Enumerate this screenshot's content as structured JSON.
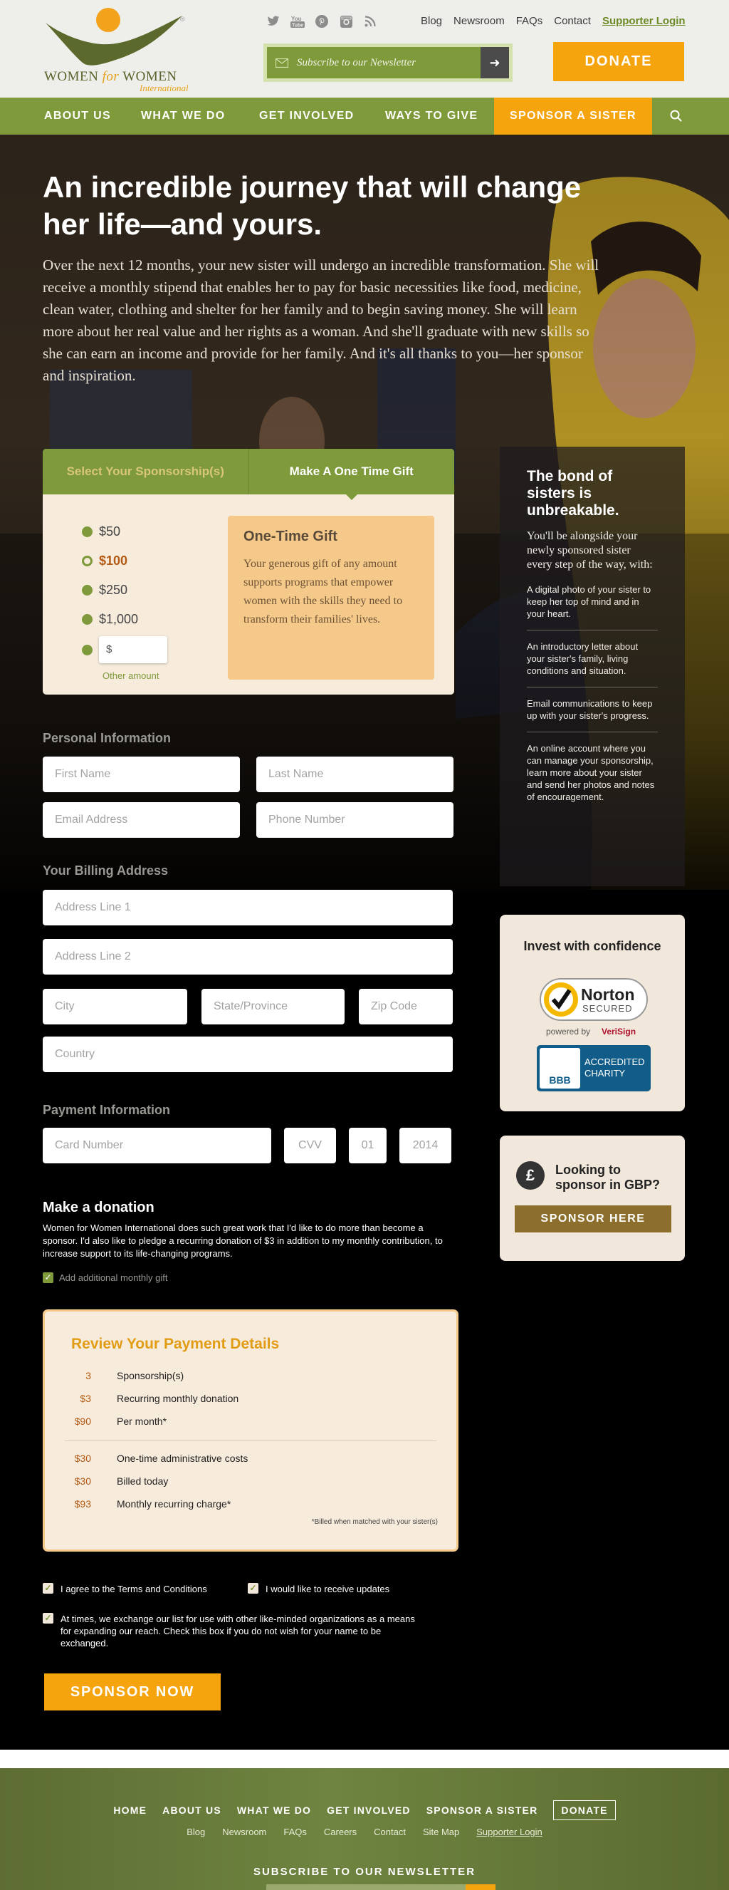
{
  "header": {
    "logo": {
      "line1": "WOMEN",
      "for": "for",
      "line2": "WOMEN",
      "intl": "International"
    },
    "socials": [
      "twitter-icon",
      "youtube-icon",
      "pinterest-icon",
      "instagram-icon",
      "rss-icon"
    ],
    "links": [
      "Blog",
      "Newsroom",
      "FAQs",
      "Contact"
    ],
    "login": "Supporter Login",
    "newsletter_placeholder": "Subscribe to our Newsletter",
    "donate": "DONATE"
  },
  "nav": {
    "items": [
      "ABOUT US",
      "WHAT WE DO",
      "GET INVOLVED",
      "WAYS TO GIVE"
    ],
    "sponsor": "SPONSOR A SISTER"
  },
  "hero": {
    "title": "An incredible journey that will change her life—and yours.",
    "body": "Over the next 12 months, your new sister will undergo an incredible transformation. She will receive a monthly stipend that enables her to pay for basic necessities like food, medicine, clean water, clothing and shelter for her family and to begin saving money. She will learn more about her real value and her rights as a woman. And she'll graduate with new skills so she can earn an income and provide for her family. And it's all thanks to you—her sponsor and inspiration."
  },
  "panel": {
    "tab1": "Select Your Sponsorship(s)",
    "tab2": "Make A One Time Gift",
    "amounts": [
      "$50",
      "$100",
      "$250",
      "$1,000"
    ],
    "selected": "$100",
    "other_placeholder": "$",
    "other_label": "Other amount",
    "gift_title": "One-Time Gift",
    "gift_text": "Your generous gift of any amount supports programs that empower women with the skills they need to transform their families' lives."
  },
  "bond": {
    "title": "The bond of sisters is unbreakable.",
    "intro": "You'll be alongside your newly sponsored sister every step of the way, with:",
    "points": [
      "A digital photo of your sister to keep her top of mind and in your heart.",
      "An introductory letter about your sister's family, living conditions and situation.",
      "Email communications to keep up with your sister's progress.",
      "An online account where you can manage your sponsorship, learn more about your sister and send her photos and notes of encouragement."
    ]
  },
  "form": {
    "personal_label": "Personal Information",
    "first_name": "First Name",
    "last_name": "Last Name",
    "email": "Email Address",
    "phone": "Phone Number",
    "billing_label": "Your Billing Address",
    "address1": "Address Line 1",
    "address2": "Address Line 2",
    "city": "City",
    "state": "State/Province",
    "zip": "Zip Code",
    "country": "Country",
    "payment_label": "Payment Information",
    "card": "Card Number",
    "cvv": "CVV",
    "month": "01",
    "year": "2014"
  },
  "confidence": {
    "title": "Invest with confidence",
    "norton": "Norton",
    "secured": "SECURED",
    "powered": "powered by",
    "verisign": "VeriSign",
    "bbb": "BBB",
    "bbb_text1": "ACCREDITED",
    "bbb_text2": "CHARITY"
  },
  "gbp": {
    "symbol": "£",
    "question1": "Looking to",
    "question2": "sponsor in GBP?",
    "button": "SPONSOR HERE"
  },
  "donation": {
    "title": "Make a donation",
    "text": "Women for Women International does such great work that I'd like to do more than become a sponsor. I'd also like to pledge a recurring donation of $3 in addition to my monthly contribution, to increase support to its life-changing programs.",
    "add_label": "Add additional monthly gift"
  },
  "review": {
    "title": "Review Your Payment Details",
    "rows1": [
      {
        "n": "3",
        "label": "Sponsorship(s)"
      },
      {
        "n": "$3",
        "label": "Recurring monthly donation"
      },
      {
        "n": "$90",
        "label": "Per month*"
      }
    ],
    "rows2": [
      {
        "n": "$30",
        "label": "One-time administrative costs"
      },
      {
        "n": "$30",
        "label": "Billed today"
      },
      {
        "n": "$93",
        "label": "Monthly recurring charge*"
      }
    ],
    "note": "*Billed when matched with your sister(s)"
  },
  "terms": {
    "agree_terms": "I agree to the Terms and Conditions",
    "updates": "I would like to receive updates",
    "exchange": "At times, we exchange our list for use with other like-minded organizations as a means for expanding our reach. Check this box if you do not wish for your name to be exchanged.",
    "sponsor_now": "SPONSOR NOW"
  },
  "footer": {
    "nav": [
      "HOME",
      "ABOUT US",
      "WHAT WE DO",
      "GET INVOLVED",
      "SPONSOR A SISTER"
    ],
    "donate": "DONATE",
    "links": [
      "Blog",
      "Newsroom",
      "FAQs",
      "Careers",
      "Contact",
      "Site Map"
    ],
    "login": "Supporter Login",
    "newsletter": "SUBSCRIBE TO OUR NEWSLETTER"
  },
  "colors": {
    "green": "#7e9a3b",
    "orange": "#f5a40d",
    "cream": "#f7ebdc",
    "peach": "#f4c98a"
  }
}
